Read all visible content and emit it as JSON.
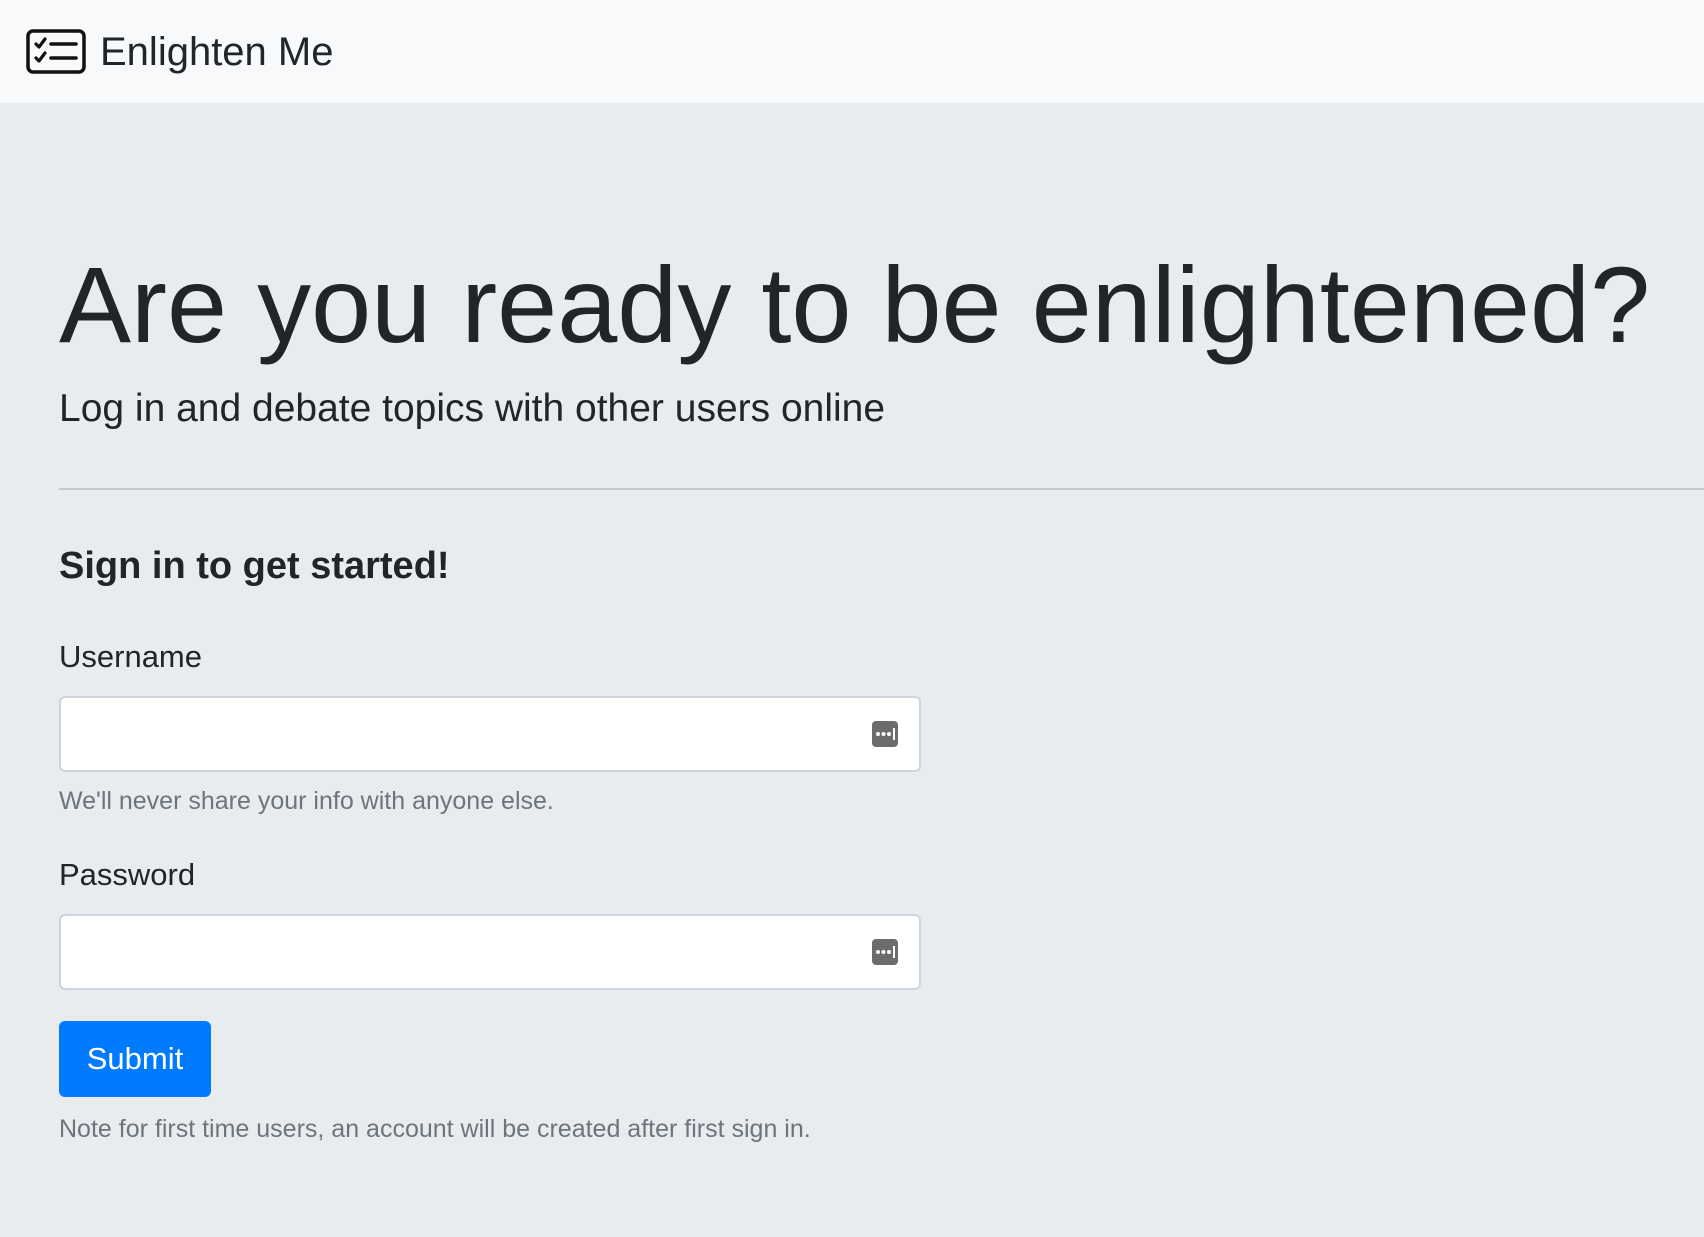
{
  "navbar": {
    "brand_name": "Enlighten Me",
    "brand_icon": "checklist-icon"
  },
  "hero": {
    "title": "Are you ready to be enlightened?",
    "lead": "Log in and debate topics with other users online"
  },
  "signin": {
    "heading": "Sign in to get started!",
    "username": {
      "label": "Username",
      "value": "",
      "help": "We'll never share your info with anyone else.",
      "icon": "password-manager-icon"
    },
    "password": {
      "label": "Password",
      "value": "",
      "icon": "password-manager-icon"
    },
    "submit_label": "Submit",
    "note": "Note for first time users, an account will be created after first sign in."
  },
  "colors": {
    "primary": "#007bff",
    "navbar_bg": "#f8f9fa",
    "page_bg": "#e9ecef",
    "muted_text": "#6c757d",
    "text": "#212529"
  }
}
